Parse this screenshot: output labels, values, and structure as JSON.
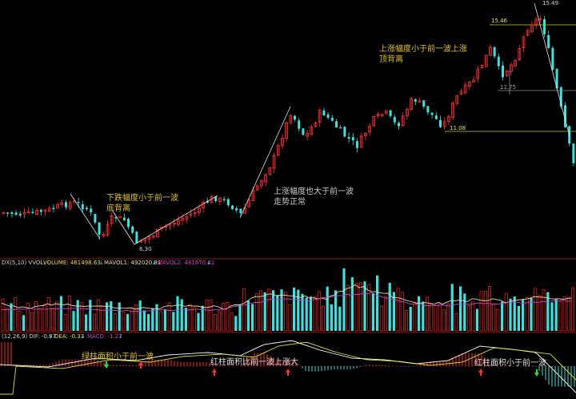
{
  "chart_data": [
    {
      "type": "candlestick",
      "panel": "price",
      "price_labels": [
        "15.49",
        "15.46",
        "12.75",
        "11.08",
        "6.30"
      ],
      "level_lines": [
        15.46,
        12.75,
        11.08
      ],
      "annotations": [
        {
          "text_lines": [
            "下跌幅度小于前一波",
            "底背离"
          ],
          "color": "#e0c020"
        },
        {
          "text_lines": [
            "上涨幅度也大于前一波",
            "走势正常"
          ],
          "color": "#c8c8c8"
        },
        {
          "text_lines": [
            "上涨幅度小于前一波上涨",
            "顶背离"
          ],
          "color": "#e0c020"
        }
      ]
    },
    {
      "type": "bar",
      "panel": "volume",
      "header": {
        "params": "DX(5,10) VVOL: -",
        "volume": "VOLUME: 461498.63",
        "mavol1": "MAVOL1: 492020.81",
        "mavol2": "MAVOL2: 481670.41"
      },
      "colors": {
        "up": "#ff3030",
        "down": "#40e0e0",
        "mavol1": "#e0e0a0",
        "mavol2": "#d040d0"
      }
    },
    {
      "type": "bar",
      "panel": "macd",
      "header": {
        "params": "(12,26,9) DIF: -0.97",
        "dea": "DEA: -0.33",
        "macd": "MACD: -1.27"
      },
      "annotations": [
        {
          "text": "绿柱面积小于前一波",
          "color": "#e0c020"
        },
        {
          "text": "红柱面积比前一波上涨大",
          "color": "#e0e0e0"
        },
        {
          "text": "红柱面积小于前一波",
          "color": "#e0e0e0"
        }
      ],
      "colors": {
        "dif": "#ffffff",
        "dea": "#e0e020",
        "pos": "#ff3030",
        "neg": "#40e0e0"
      }
    }
  ]
}
